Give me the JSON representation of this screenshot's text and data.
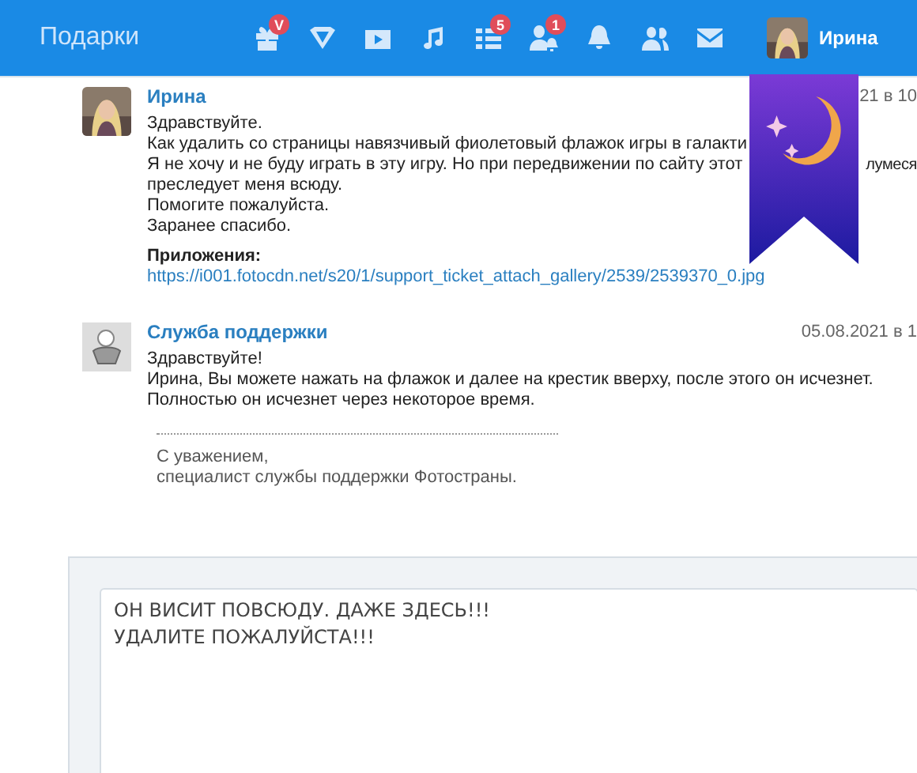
{
  "header": {
    "title": "Подарки",
    "nav_icons": [
      {
        "kind": "gift",
        "badge": "V"
      },
      {
        "kind": "diamond"
      },
      {
        "kind": "video"
      },
      {
        "kind": "music"
      },
      {
        "kind": "list",
        "badge": "5"
      },
      {
        "kind": "person-bell",
        "badge": "1"
      },
      {
        "kind": "bell"
      },
      {
        "kind": "people"
      },
      {
        "kind": "mail"
      }
    ],
    "user": {
      "name": "Ирина"
    }
  },
  "messages": [
    {
      "kind": "user",
      "author": "Ирина",
      "date": "21 в 10",
      "lines": [
        {
          "text": "Здравствуйте."
        },
        {
          "text": "Как удалить со страницы навязчивый фиолетовый флажок игры в галакти"
        },
        {
          "text": "Я не хочу и не буду играть в эту игру. Но при передвижении по сайту этот",
          "tail": "лумеся"
        },
        {
          "text": "преследует меня всюду."
        },
        {
          "text": "Помогите пожалуйста."
        },
        {
          "text": "Заранее спасибо."
        }
      ],
      "attachments_label": "Приложения:",
      "attachment_link": "https://i001.fotocdn.net/s20/1/support_ticket_attach_gallery/2539/2539370_0.jpg"
    },
    {
      "kind": "support",
      "author": "Служба поддержки",
      "date": "05.08.2021 в 1",
      "lines": [
        {
          "text": "Здравствуйте!"
        },
        {
          "text": "Ирина, Вы можете нажать на флажок и далее на крестик вверху, после этого он исчезнет."
        },
        {
          "text": "Полностью он исчезнет через некоторое время."
        }
      ],
      "signature": [
        "С уважением,",
        "специалист службы поддержки Фотостраны."
      ]
    }
  ],
  "reply": {
    "value": "ОН ВИСИТ ПОВСЮДУ. ДАЖЕ ЗДЕСЬ!!!\nУДАЛИТЕ ПОЖАЛУЙСТА!!!"
  }
}
